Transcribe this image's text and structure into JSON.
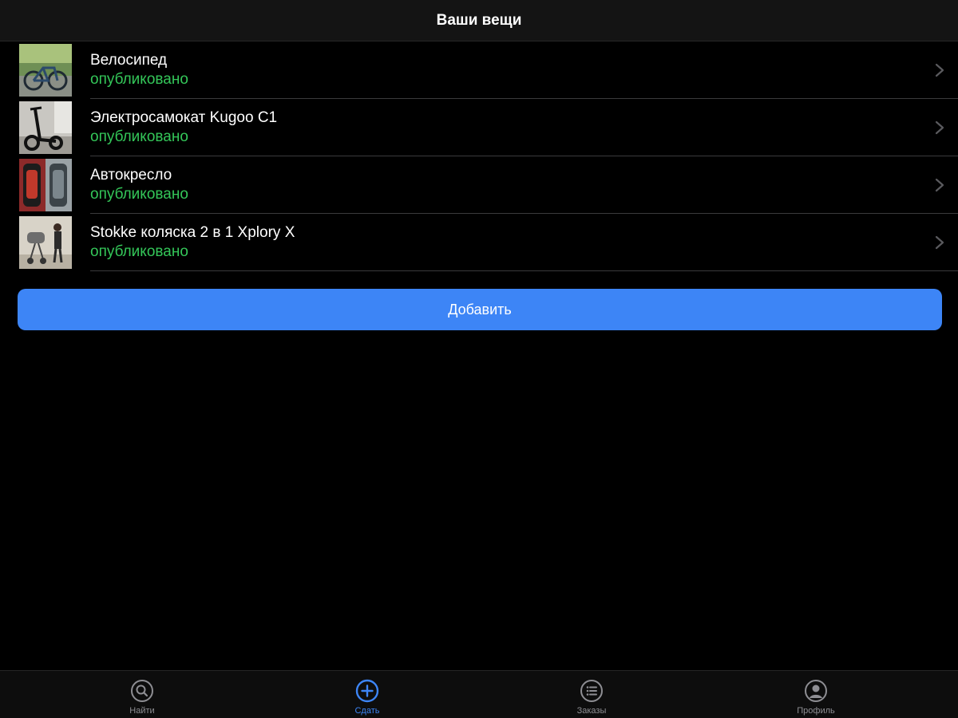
{
  "header": {
    "title": "Ваши вещи"
  },
  "items": [
    {
      "title": "Велосипед",
      "status": "опубликовано"
    },
    {
      "title": "Электросамокат Kugoo C1",
      "status": "опубликовано"
    },
    {
      "title": "Автокресло",
      "status": "опубликовано"
    },
    {
      "title": "Stokke коляска 2 в 1 Xplory X",
      "status": "опубликовано"
    }
  ],
  "add_button": {
    "label": "Добавить"
  },
  "tabbar": {
    "tabs": [
      {
        "label": "Найти",
        "icon": "search-icon",
        "active": false
      },
      {
        "label": "Сдать",
        "icon": "plus-circle-icon",
        "active": true
      },
      {
        "label": "Заказы",
        "icon": "list-icon",
        "active": false
      },
      {
        "label": "Профиль",
        "icon": "profile-icon",
        "active": false
      }
    ]
  },
  "colors": {
    "background": "#000000",
    "status_published": "#34c759",
    "accent": "#3d85f6",
    "tab_inactive": "#8e8e93",
    "separator": "#3a3a3c"
  }
}
